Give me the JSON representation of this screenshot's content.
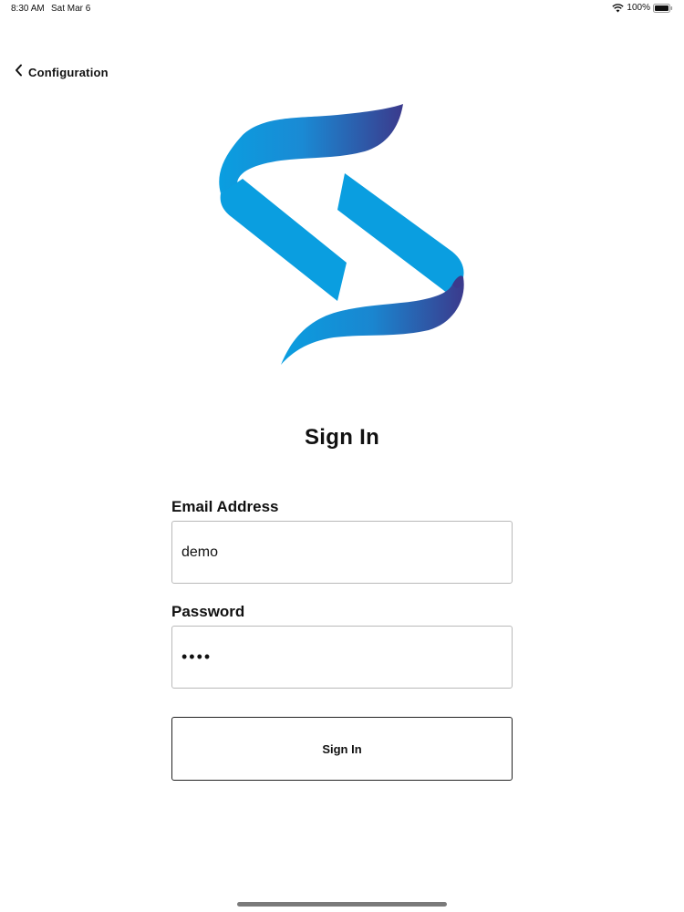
{
  "status_bar": {
    "time": "8:30 AM",
    "date": "Sat Mar 6",
    "battery": "100%"
  },
  "nav": {
    "back_label": "Configuration"
  },
  "logo": {
    "icon": "brand-s-logo",
    "colors": {
      "light_blue": "#0a9ee0",
      "dark_blue": "#3a3a8e"
    }
  },
  "page": {
    "title": "Sign In"
  },
  "form": {
    "email_label": "Email Address",
    "email_value": "demo",
    "password_label": "Password",
    "password_value": "demo",
    "submit_label": "Sign In"
  }
}
